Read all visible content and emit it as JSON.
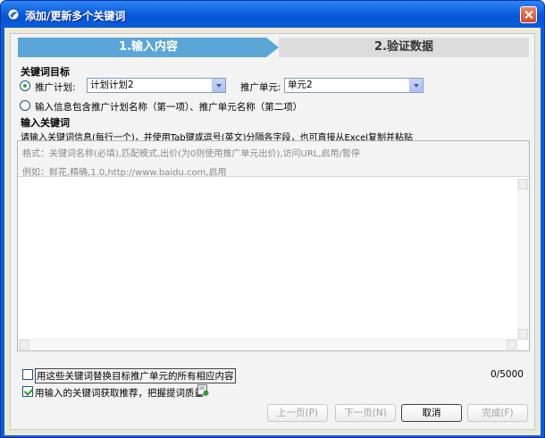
{
  "window": {
    "title": "添加/更新多个关键词"
  },
  "steps": [
    {
      "label": "1.输入内容"
    },
    {
      "label": "2.验证数据"
    }
  ],
  "target": {
    "heading": "关键词目标",
    "radio_plan_label": "推广计划:",
    "plan_select_value": "计划计划2",
    "unit_label": "推广单元:",
    "unit_select_value": "单元2",
    "radio_info_label": "输入信息包含推广计划名称（第一项）、推广单元名称（第二项）"
  },
  "keywords": {
    "heading": "输入关键词",
    "description": "请输入关键词信息(每行一个)，并使用Tab键或逗号(英文)分隔各字段，也可直接从Excel复制并粘贴",
    "format_hint": "格式：关键词名称(必填),匹配模式,出价(为0则使用推广单元出价),访问URL,启用/暂停",
    "example_hint": "例如：鲜花,精确,1.0,http://www.baidu.com,启用",
    "counter": "0/5000"
  },
  "options": {
    "replace_label": "用这些关键词替换目标推广单元的所有相应内容",
    "replace_checked": false,
    "recommend_label": "用输入的关键词获取推荐，把握提词质量!",
    "recommend_checked": true
  },
  "buttons": {
    "prev": "上一页(P)",
    "next": "下一页(N)",
    "cancel": "取消",
    "finish": "完成(F)"
  },
  "colors": {
    "active_step": "#5ba6d7",
    "inactive_step": "#dcdcdc",
    "titlebar": "#0b5fe0"
  }
}
